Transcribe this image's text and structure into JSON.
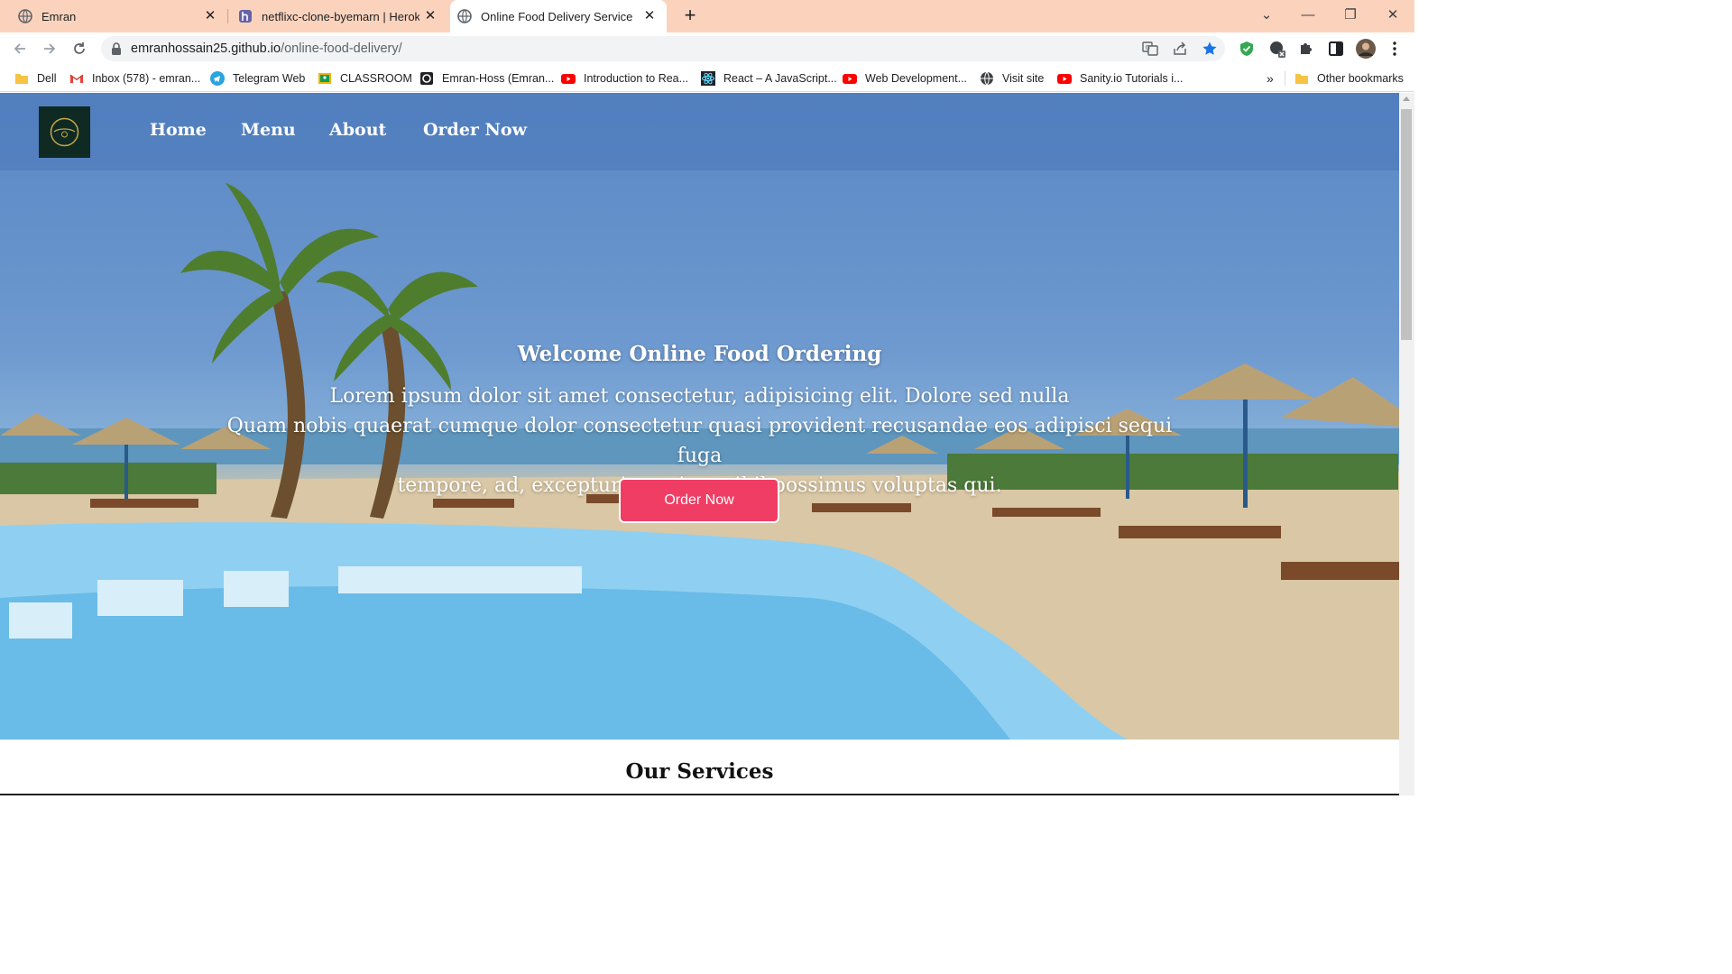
{
  "browser": {
    "tabs": [
      {
        "title": "Emran",
        "favicon": "globe-icon",
        "active": false
      },
      {
        "title": "netflixc-clone-byemarn | Heroku",
        "favicon": "heroku-icon",
        "active": false
      },
      {
        "title": "Online Food Delivery Service In I",
        "favicon": "globe-icon",
        "active": true
      }
    ],
    "new_tab_symbol": "+",
    "close_symbol": "✕",
    "window_controls": {
      "tab_search": "⌄",
      "minimize": "—",
      "restore": "❐",
      "close": "✕"
    },
    "address": {
      "host": "emranhossain25.github.io",
      "path": "/online-food-delivery/"
    },
    "bookmarks": [
      {
        "label": "Dell",
        "icon": "folder-icon"
      },
      {
        "label": "Inbox (578) - emran...",
        "icon": "gmail-icon"
      },
      {
        "label": "Telegram Web",
        "icon": "telegram-icon"
      },
      {
        "label": "CLASSROOM",
        "icon": "classroom-icon"
      },
      {
        "label": "Emran-Hoss (Emran...",
        "icon": "github-icon"
      },
      {
        "label": "Introduction to Rea...",
        "icon": "youtube-icon"
      },
      {
        "label": "React – A JavaScript...",
        "icon": "react-icon"
      },
      {
        "label": "Web Development...",
        "icon": "youtube-icon"
      },
      {
        "label": "Visit site",
        "icon": "globe-icon"
      },
      {
        "label": "Sanity.io Tutorials i...",
        "icon": "youtube-icon"
      }
    ],
    "bookmarks_overflow": "»",
    "other_bookmarks": "Other bookmarks",
    "colors": {
      "tabstrip": "#fbd3bd",
      "star": "#1a73e8"
    }
  },
  "site": {
    "nav": [
      "Home",
      "Menu",
      "About",
      "Order Now"
    ],
    "hero": {
      "title": "Welcome Online Food Ordering",
      "line1": "Lorem ipsum dolor sit amet consectetur, adipisicing elit. Dolore sed nulla",
      "line2": "Quam nobis quaerat cumque dolor consectetur quasi provident recusandae eos adipisci sequi fuga",
      "line3": "tempore, ad, excepturi aperiam nihil possimus voluptas qui.",
      "button": "Order Now"
    },
    "services_title": "Our Services",
    "colors": {
      "button": "#f03d64",
      "nav_overlay": "#4a79ba"
    }
  }
}
